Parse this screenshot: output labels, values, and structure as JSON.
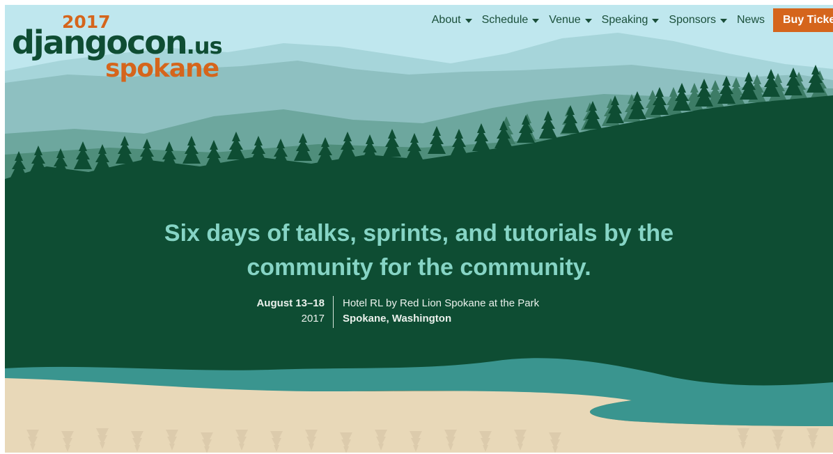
{
  "logo": {
    "year": "2017",
    "name": "djangocon",
    "domain": ".us",
    "city": "spokane"
  },
  "nav": {
    "items": [
      {
        "label": "About"
      },
      {
        "label": "Schedule"
      },
      {
        "label": "Venue"
      },
      {
        "label": "Speaking"
      },
      {
        "label": "Sponsors"
      }
    ],
    "news": "News",
    "buy": "Buy Tickets",
    "dropdown_icon": "caret-down-icon"
  },
  "hero": {
    "tagline_line1": "Six days of talks, sprints, and tutorials by the",
    "tagline_line2": "community for the community.",
    "date": "August 13–18",
    "year": "2017",
    "venue": "Hotel RL by Red Lion Spokane at the Park",
    "location": "Spokane, Washington"
  },
  "colors": {
    "brand_orange": "#d5651c",
    "forest_green": "#0f4d33",
    "tagline_teal": "#86d4c5",
    "river_teal": "#3a958f",
    "sand": "#e8d8b8",
    "sky": "#bfe7ee"
  }
}
